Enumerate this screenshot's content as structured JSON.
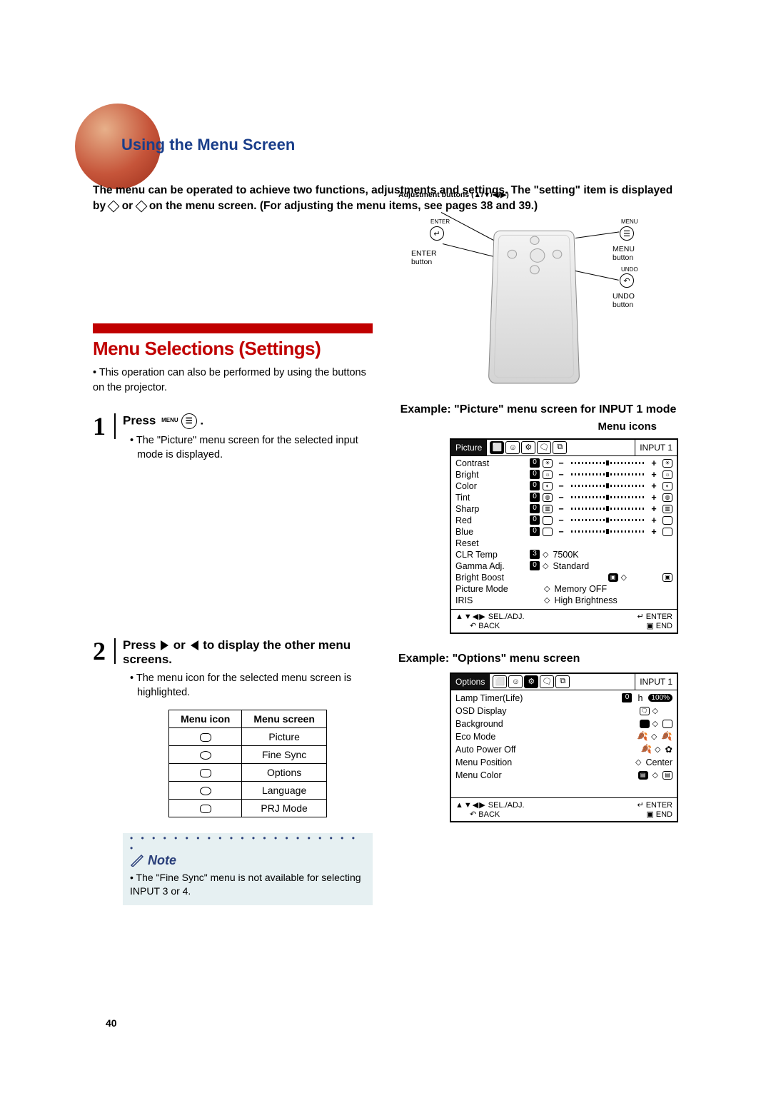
{
  "header": {
    "title": "Using the Menu Screen",
    "intro": "The menu can be operated to achieve two functions, adjustments and settings. The \"setting\" item is displayed by   or   on the menu screen. (For adjusting the menu items, see pages 38 and 39.)"
  },
  "remote_labels": {
    "adjustment": "Adjustment buttons (▲/▼/◀/▶)",
    "enter": "ENTER",
    "enter_sub": "button",
    "menu": "MENU",
    "menu_sub": "button",
    "undo": "UNDO",
    "undo_sub": "button",
    "enter_topsmall": "ENTER",
    "menu_topsmall": "MENU",
    "undo_topsmall": "UNDO"
  },
  "main_heading": "Menu Selections (Settings)",
  "main_bullet": "• This operation can also be performed by using the buttons on the projector.",
  "steps": {
    "1": {
      "title": "Press",
      "menu_icon_label": "MENU",
      "bullet": "• The \"Picture\" menu screen for the selected input mode is displayed."
    },
    "2": {
      "title_a": "Press",
      "title_b": "or",
      "title_c": "to display the other menu screens.",
      "bullet": "• The menu icon for the selected menu screen is highlighted."
    }
  },
  "menu_table": {
    "head_icon": "Menu icon",
    "head_screen": "Menu screen",
    "rows": [
      "Picture",
      "Fine Sync",
      "Options",
      "Language",
      "PRJ Mode"
    ]
  },
  "note": {
    "title": "Note",
    "text": "• The \"Fine Sync\" menu is not available for selecting INPUT 3 or 4."
  },
  "right": {
    "example1": "Example: \"Picture\" menu screen for INPUT 1 mode",
    "menu_icons": "Menu icons",
    "example2": "Example: \"Options\" menu screen"
  },
  "osd_picture": {
    "tab": "Picture",
    "input": "INPUT 1",
    "rows_slider": [
      "Contrast",
      "Bright",
      "Color",
      "Tint",
      "Sharp",
      "Red",
      "Blue"
    ],
    "slider_value": "0",
    "reset": "Reset",
    "setting_rows": [
      {
        "lbl": "CLR Temp",
        "val": "3",
        "txt": "7500K"
      },
      {
        "lbl": "Gamma Adj.",
        "val": "0",
        "txt": "Standard"
      },
      {
        "lbl": "Bright Boost",
        "val": "",
        "txt": ""
      },
      {
        "lbl": "Picture Mode",
        "val": "",
        "txt": "Memory OFF"
      },
      {
        "lbl": "IRIS",
        "val": "",
        "txt": "High Brightness"
      }
    ],
    "footer": {
      "sel": "SEL./ADJ.",
      "enter": "ENTER",
      "back": "BACK",
      "end": "END"
    }
  },
  "osd_options": {
    "tab": "Options",
    "input": "INPUT 1",
    "rows": [
      {
        "lbl": "Lamp Timer(Life)",
        "extra_val": "0",
        "extra_unit": "h",
        "extra_pct": "100%"
      },
      {
        "lbl": "OSD Display"
      },
      {
        "lbl": "Background"
      },
      {
        "lbl": "Eco Mode"
      },
      {
        "lbl": "Auto Power Off"
      },
      {
        "lbl": "Menu Position",
        "txt": "Center"
      },
      {
        "lbl": "Menu Color"
      }
    ],
    "footer": {
      "sel": "SEL./ADJ.",
      "enter": "ENTER",
      "back": "BACK",
      "end": "END"
    }
  },
  "page_number": "40"
}
